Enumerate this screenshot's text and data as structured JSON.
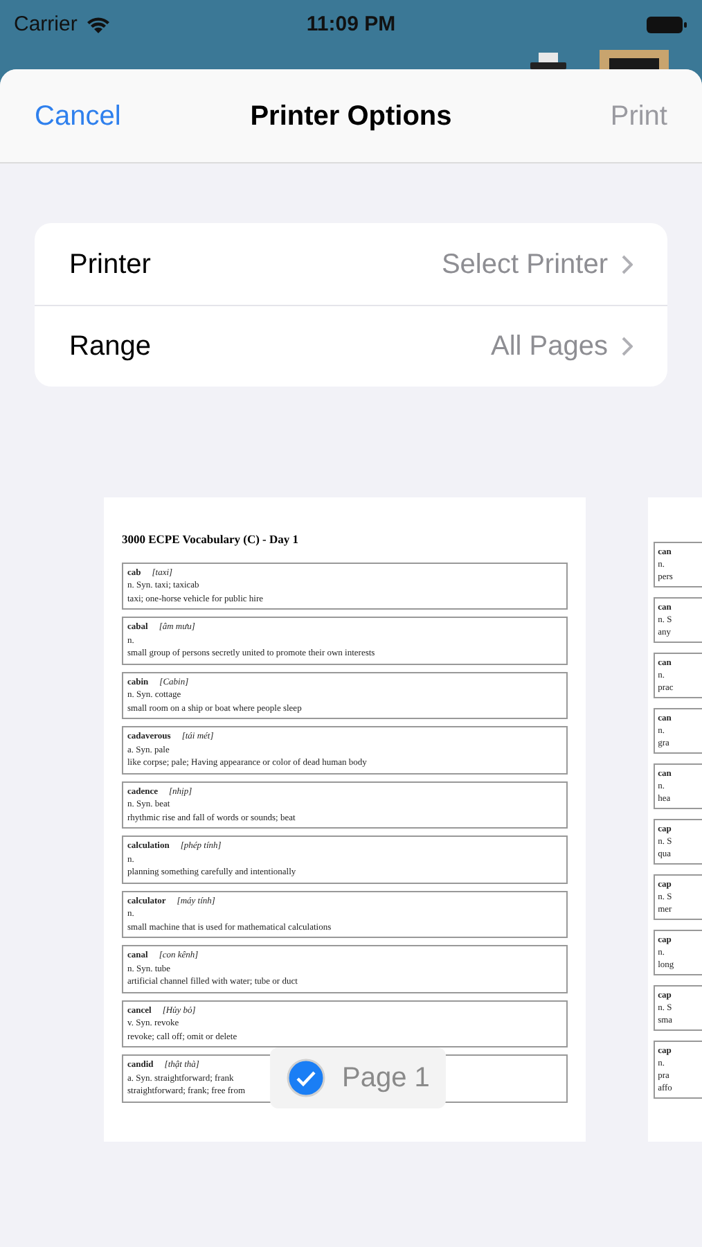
{
  "status_bar": {
    "carrier": "Carrier",
    "time": "11:09 PM"
  },
  "sheet": {
    "cancel": "Cancel",
    "title": "Printer Options",
    "print": {
      "label": "Print",
      "disabled": true
    }
  },
  "options": [
    {
      "label": "Printer",
      "value": "Select Printer"
    },
    {
      "label": "Range",
      "value": "All Pages"
    }
  ],
  "preview": {
    "title": "3000 ECPE Vocabulary (C) - Day 1",
    "entries": [
      {
        "word": "cab",
        "gloss": "[taxi]",
        "lines": [
          "n. Syn. taxi; taxicab",
          "taxi; one-horse vehicle for public hire"
        ]
      },
      {
        "word": "cabal",
        "gloss": "[âm mưu]",
        "lines": [
          "n.",
          "small group of persons secretly united to promote their own interests"
        ]
      },
      {
        "word": "cabin",
        "gloss": "[Cabin]",
        "lines": [
          "n. Syn. cottage",
          "small room on a ship or boat where people sleep"
        ]
      },
      {
        "word": "cadaverous",
        "gloss": "[tái mét]",
        "lines": [
          "a. Syn. pale",
          "like corpse; pale; Having appearance or color of dead human body"
        ]
      },
      {
        "word": "cadence",
        "gloss": "[nhịp]",
        "lines": [
          "n. Syn. beat",
          "rhythmic rise and fall of words or sounds; beat"
        ]
      },
      {
        "word": "calculation",
        "gloss": "[phép tính]",
        "lines": [
          "n.",
          "planning something carefully and intentionally"
        ]
      },
      {
        "word": "calculator",
        "gloss": "[máy tính]",
        "lines": [
          "n.",
          "small machine that is used for mathematical calculations"
        ]
      },
      {
        "word": "canal",
        "gloss": "[con kênh]",
        "lines": [
          "n. Syn. tube",
          "artificial channel filled with water; tube or duct"
        ]
      },
      {
        "word": "cancel",
        "gloss": "[Hủy bỏ]",
        "lines": [
          "v. Syn. revoke",
          "revoke; call off; omit or delete"
        ]
      },
      {
        "word": "candid",
        "gloss": "[thật thà]",
        "lines": [
          "a. Syn. straightforward; frank",
          "straightforward; frank; free from"
        ]
      }
    ],
    "page_badge": {
      "label": "Page 1",
      "selected": true
    },
    "next_page_entries": [
      {
        "word": "can",
        "lines": [
          "n.",
          "pers"
        ]
      },
      {
        "word": "can",
        "lines": [
          "n. S",
          "any"
        ]
      },
      {
        "word": "can",
        "lines": [
          "n.",
          "prac"
        ]
      },
      {
        "word": "can",
        "lines": [
          "n.",
          "gra"
        ]
      },
      {
        "word": "can",
        "lines": [
          "n.",
          "hea"
        ]
      },
      {
        "word": "cap",
        "lines": [
          "n. S",
          "qua"
        ]
      },
      {
        "word": "cap",
        "lines": [
          "n. S",
          "mer"
        ]
      },
      {
        "word": "cap",
        "lines": [
          "n.",
          "long"
        ]
      },
      {
        "word": "cap",
        "lines": [
          "n. S",
          "sma"
        ]
      },
      {
        "word": "cap",
        "lines": [
          "n.",
          "pra",
          "affo"
        ]
      }
    ]
  }
}
